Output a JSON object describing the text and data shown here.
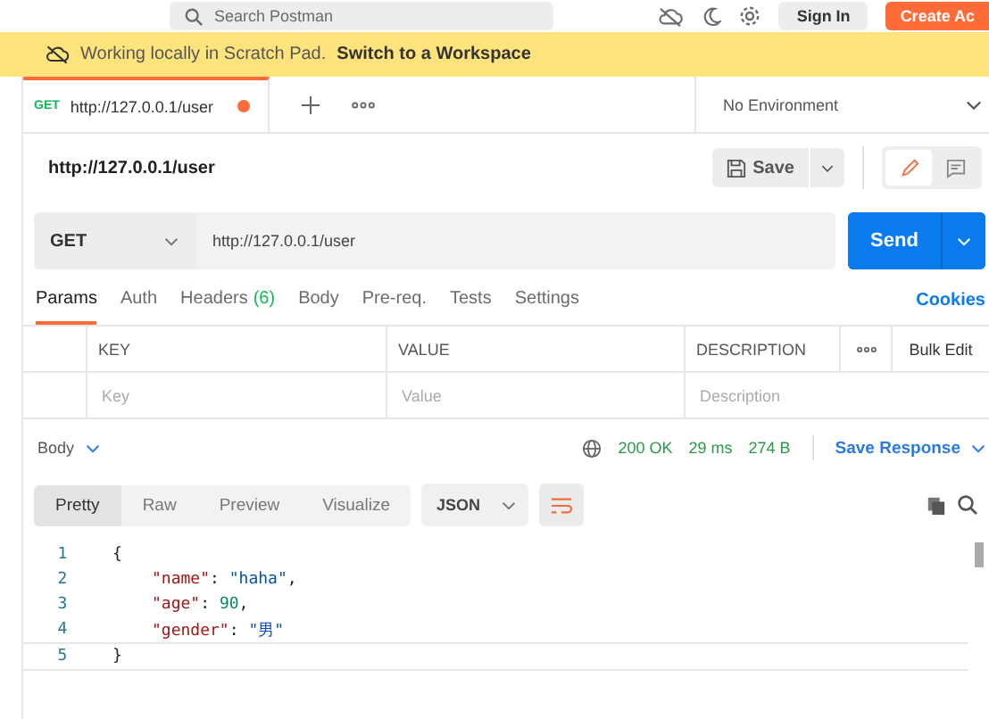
{
  "top_bar": {
    "search_placeholder": "Search Postman",
    "sign_in": "Sign In",
    "create_account": "Create Ac"
  },
  "banner": {
    "text": "Working locally in Scratch Pad.",
    "link": "Switch to a Workspace"
  },
  "request_tabs": [
    {
      "method": "GET",
      "url": "http://127.0.0.1/user",
      "unsaved": true,
      "selected": true
    }
  ],
  "environment": {
    "value": "No Environment"
  },
  "request_title": "http://127.0.0.1/user",
  "save_button": "Save",
  "url_bar": {
    "method": "GET",
    "url": "http://127.0.0.1/user",
    "send": "Send"
  },
  "param_tabs": [
    {
      "label": "Params",
      "selected": true
    },
    {
      "label": "Auth",
      "selected": false
    },
    {
      "label": "Headers",
      "count": "(6)",
      "selected": false
    },
    {
      "label": "Body",
      "selected": false
    },
    {
      "label": "Pre-req.",
      "selected": false
    },
    {
      "label": "Tests",
      "selected": false
    },
    {
      "label": "Settings",
      "selected": false
    }
  ],
  "cookies_link": "Cookies",
  "params_table": {
    "columns": [
      "KEY",
      "VALUE",
      "DESCRIPTION"
    ],
    "bulk_edit": "Bulk Edit",
    "placeholders": [
      "Key",
      "Value",
      "Description"
    ]
  },
  "response": {
    "section": "Body",
    "status": "200 OK",
    "time": "29 ms",
    "size": "274 B",
    "save_response": "Save Response"
  },
  "view_tabs": [
    {
      "label": "Pretty",
      "selected": true
    },
    {
      "label": "Raw",
      "selected": false
    },
    {
      "label": "Preview",
      "selected": false
    },
    {
      "label": "Visualize",
      "selected": false
    }
  ],
  "format": "JSON",
  "code_lines": [
    {
      "number": "1",
      "indented": false,
      "tokens": [
        {
          "kind": "punct",
          "text": "{"
        }
      ]
    },
    {
      "number": "2",
      "indented": true,
      "tokens": [
        {
          "kind": "key",
          "text": "\"name\""
        },
        {
          "kind": "punct",
          "text": ": "
        },
        {
          "kind": "string",
          "text": "\"haha\""
        },
        {
          "kind": "punct",
          "text": ","
        }
      ]
    },
    {
      "number": "3",
      "indented": true,
      "tokens": [
        {
          "kind": "key",
          "text": "\"age\""
        },
        {
          "kind": "punct",
          "text": ": "
        },
        {
          "kind": "number",
          "text": "90"
        },
        {
          "kind": "punct",
          "text": ","
        }
      ]
    },
    {
      "number": "4",
      "indented": true,
      "tokens": [
        {
          "kind": "key",
          "text": "\"gender\""
        },
        {
          "kind": "punct",
          "text": ": "
        },
        {
          "kind": "string",
          "text": "\"男\""
        }
      ]
    },
    {
      "number": "5",
      "indented": false,
      "tokens": [
        {
          "kind": "punct",
          "text": "}"
        }
      ]
    }
  ]
}
